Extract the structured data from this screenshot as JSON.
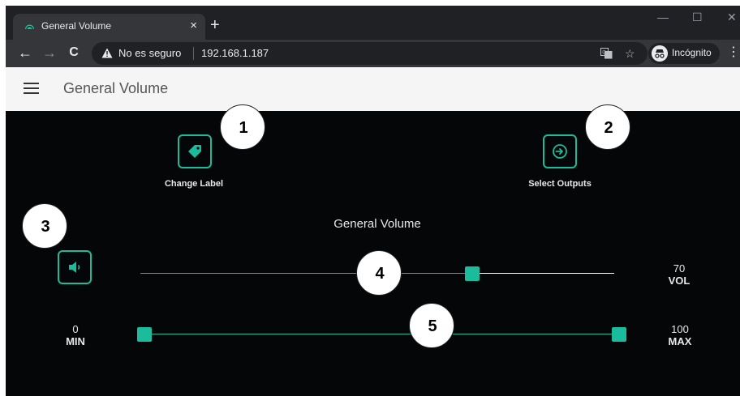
{
  "browser": {
    "tab_title": "General Volume",
    "tab_close": "×",
    "new_tab": "+",
    "window_controls": {
      "minimize": "—",
      "maximize": "☐",
      "close": "✕"
    },
    "nav": {
      "back": "←",
      "forward": "→",
      "reload": "C"
    },
    "security_text": "No es seguro",
    "url": "192.168.1.187",
    "icons": {
      "translate": "translate-icon",
      "bookmark": "☆"
    },
    "profile_label": "Incógnito",
    "menu": "⋮"
  },
  "app": {
    "title": "General Volume"
  },
  "actions": {
    "change_label": "Change Label",
    "select_outputs": "Select Outputs"
  },
  "volume": {
    "section_title": "General Volume",
    "value": "70",
    "unit": "VOL",
    "level_fraction": 0.7,
    "range": {
      "min_value": "0",
      "min_label": "MIN",
      "max_value": "100",
      "max_label": "MAX"
    }
  },
  "markers": [
    "1",
    "2",
    "3",
    "4",
    "5"
  ],
  "colors": {
    "accent": "#1abc9c",
    "content_bg": "#050607",
    "header_bg": "#f5f5f5"
  }
}
